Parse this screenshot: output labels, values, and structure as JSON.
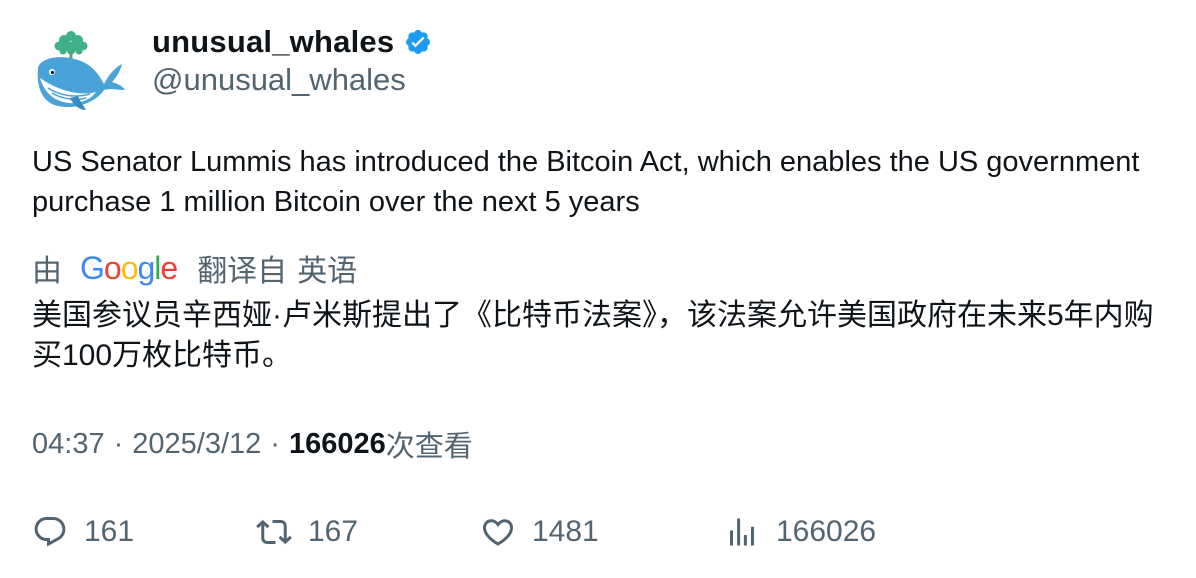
{
  "author": {
    "display_name": "unusual_whales",
    "handle": "@unusual_whales",
    "verified": true,
    "avatar_icon": "whale-icon"
  },
  "tweet": {
    "text": "US Senator Lummis has introduced the Bitcoin Act, which enables the US government purchase 1 million Bitcoin over the next 5 years"
  },
  "translation": {
    "by_label": "由",
    "provider": "Google",
    "from_label": "翻译自",
    "language": "英语",
    "text": "美国参议员辛西娅·卢米斯提出了《比特币法案》，该法案允许美国政府在未来5年内购买100万枚比特币。"
  },
  "meta": {
    "time": "04:37",
    "separator": "·",
    "date": "2025/3/12",
    "views_count": "166026",
    "views_label": "次查看"
  },
  "actions": {
    "replies": "161",
    "retweets": "167",
    "likes": "1481",
    "views": "166026"
  },
  "colors": {
    "text_primary": "#0f1419",
    "text_secondary": "#536471",
    "verified_blue": "#1d9bf0",
    "whale_blue": "#4aa3d8",
    "tree_green": "#3fb08a"
  }
}
